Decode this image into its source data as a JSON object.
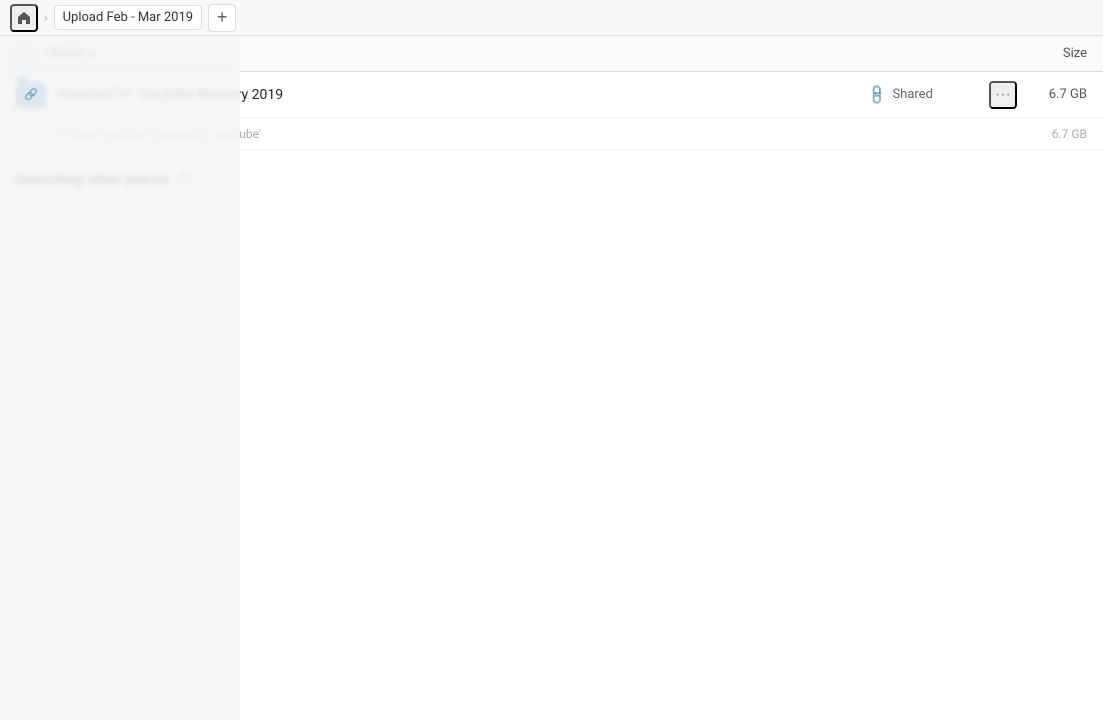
{
  "topbar": {
    "home_icon": "🏠",
    "breadcrumb_separator": "›",
    "title": "Upload Feb - Mar 2019",
    "add_label": "+"
  },
  "columns": {
    "name_label": "Name",
    "sort_indicator": "▲",
    "size_label": "Size"
  },
  "file": {
    "name": "HoomanTV - YouTube Mastery 2019",
    "shared_label": "Shared",
    "size": "6.7 GB",
    "more_icon": "···"
  },
  "summary": {
    "text": "1 folder matches 'hoomantv - youtube'",
    "size": "6.7 GB"
  },
  "searching": {
    "title": "Searching other places",
    "spinner_label": "loading"
  }
}
